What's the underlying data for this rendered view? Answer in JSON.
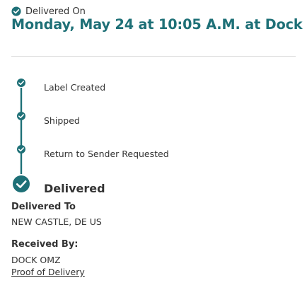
{
  "status": {
    "label": "Delivered On",
    "headline": "Monday, May 24 at 10:05 A.M. at Dock"
  },
  "timeline": {
    "events": [
      {
        "label": "Label Created",
        "final": false
      },
      {
        "label": "Shipped",
        "final": false
      },
      {
        "label": "Return to Sender Requested",
        "final": false
      },
      {
        "label": "Delivered",
        "final": true
      }
    ]
  },
  "delivery": {
    "delivered_to_label": "Delivered To",
    "delivered_to_value": "NEW CASTLE, DE US",
    "received_by_label": "Received By:",
    "received_by_value": "DOCK OMZ",
    "proof_link": "Proof of Delivery"
  },
  "colors": {
    "accent": "#1e7077",
    "text": "#333333",
    "icon": "check-circle-icon"
  }
}
